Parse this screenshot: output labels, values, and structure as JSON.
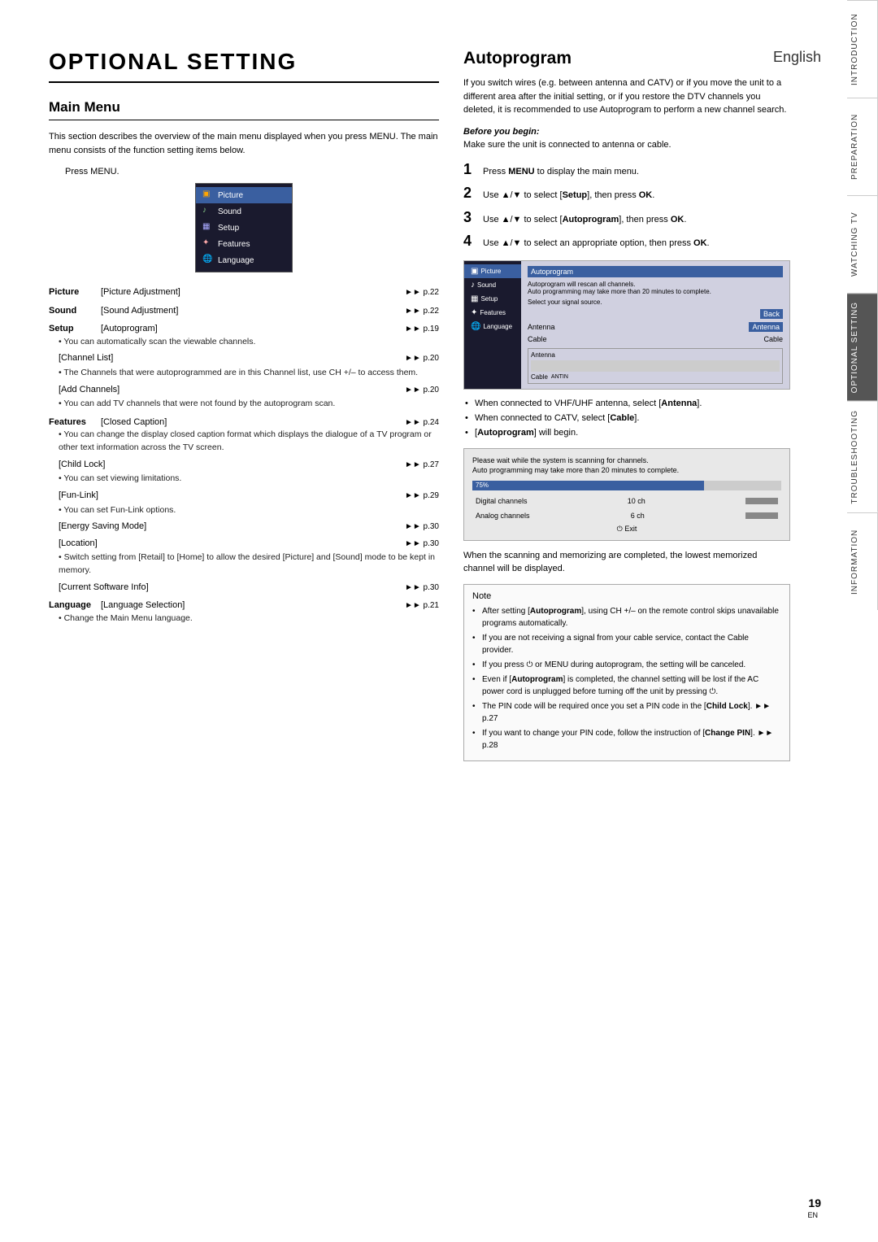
{
  "language": "English",
  "page_number": "19",
  "page_number_sub": "EN",
  "side_tabs": [
    {
      "label": "INTRODUCTION",
      "active": false
    },
    {
      "label": "PREPARATION",
      "active": false
    },
    {
      "label": "WATCHING TV",
      "active": false
    },
    {
      "label": "OPTIONAL SETTING",
      "active": true
    },
    {
      "label": "TROUBLESHOOTING",
      "active": false
    },
    {
      "label": "INFORMATION",
      "active": false
    }
  ],
  "left": {
    "main_title": "OPTIONAL SETTING",
    "sub_title": "Main Menu",
    "intro": "This section describes the overview of the main menu displayed when you press MENU. The main menu consists of the function setting items below.",
    "press_menu": "Press MENU.",
    "menu_items": [
      {
        "label": "Picture",
        "icon": "🖼"
      },
      {
        "label": "Sound",
        "icon": "🔊"
      },
      {
        "label": "Setup",
        "icon": "⚙"
      },
      {
        "label": "Features",
        "icon": "✦"
      },
      {
        "label": "Language",
        "icon": "🌐"
      }
    ],
    "entries": [
      {
        "category": "Picture",
        "items": [
          {
            "name": "[Picture Adjustment]",
            "page": "p.22",
            "bullets": []
          }
        ]
      },
      {
        "category": "Sound",
        "items": [
          {
            "name": "[Sound Adjustment]",
            "page": "p.22",
            "bullets": []
          }
        ]
      },
      {
        "category": "Setup",
        "items": [
          {
            "name": "[Autoprogram]",
            "page": "p.19",
            "bullets": [
              "You can automatically scan the viewable channels."
            ]
          },
          {
            "name": "[Channel List]",
            "page": "p.20",
            "bullets": [
              "The Channels that were autoprogrammed are in this Channel list, use CH +/– to access them."
            ]
          },
          {
            "name": "[Add Channels]",
            "page": "p.20",
            "bullets": [
              "You can add TV channels that were not found by the autoprogram scan."
            ]
          }
        ]
      },
      {
        "category": "Features",
        "items": [
          {
            "name": "[Closed Caption]",
            "page": "p.24",
            "bullets": [
              "You can change the display closed caption format which displays the dialogue of a TV program or other text information across the TV screen."
            ]
          },
          {
            "name": "[Child Lock]",
            "page": "p.27",
            "bullets": [
              "You can set viewing limitations."
            ]
          },
          {
            "name": "[Fun-Link]",
            "page": "p.29",
            "bullets": [
              "You can set Fun-Link options."
            ]
          },
          {
            "name": "[Energy Saving Mode]",
            "page": "p.30",
            "bullets": []
          },
          {
            "name": "[Location]",
            "page": "p.30",
            "bullets": [
              "Switch setting from [Retail] to [Home] to allow the desired [Picture] and [Sound] mode to be kept in memory."
            ]
          },
          {
            "name": "[Current Software Info]",
            "page": "p.30",
            "bullets": []
          }
        ]
      },
      {
        "category": "Language",
        "items": [
          {
            "name": "[Language Selection]",
            "page": "p.21",
            "bullets": [
              "Change the Main Menu language."
            ]
          }
        ]
      }
    ]
  },
  "right": {
    "title": "Autoprogram",
    "intro": "If you switch wires (e.g. between antenna and CATV) or if you move the unit to a different area after the initial setting, or if you restore the DTV channels you deleted, it is recommended to use Autoprogram to perform a new channel search.",
    "before_begin_label": "Before you begin:",
    "before_begin_text": "Make sure the unit is connected to antenna or cable.",
    "steps": [
      {
        "number": "1",
        "text": "Press MENU to display the main menu."
      },
      {
        "number": "2",
        "text": "Use ▲/▼ to select [Setup], then press OK."
      },
      {
        "number": "3",
        "text": "Use ▲/▼ to select [Autoprogram], then press OK."
      },
      {
        "number": "4",
        "text": "Use ▲/▼ to select an appropriate option, then press OK."
      }
    ],
    "screenshot_title": "Autoprogram",
    "screenshot_options": [
      "Back",
      "Antenna",
      "Cable"
    ],
    "screenshot_note_text": "Autoprogram will rescan all channels. Auto programming may take more than 20 minutes to complete.",
    "screenshot_select_text": "Select your signal source.",
    "bullets_after_screenshot": [
      "When connected to VHF/UHF antenna, select [Antenna].",
      "When connected to CATV, select [Cable].",
      "[Autoprogram] will begin."
    ],
    "progress_note": "Please wait while the system is scanning for channels.\nAuto programming may take more than 20 minutes to complete.",
    "progress_percent": "75%",
    "digital_channels_label": "Digital channels",
    "digital_channels_value": "10 ch",
    "analog_channels_label": "Analog channels",
    "analog_channels_value": "6 ch",
    "exit_label": "Exit",
    "scanning_complete_text": "When the scanning and memorizing are completed, the lowest memorized channel will be displayed.",
    "note_title": "Note",
    "notes": [
      "After setting [Autoprogram], using CH +/– on the remote control skips unavailable programs automatically.",
      "If you are not receiving a signal from your cable service, contact the Cable provider.",
      "If you press ⏻ or MENU during autoprogram, the setting will be canceled.",
      "Even if [Autoprogram] is completed, the channel setting will be lost if the AC power cord is unplugged before turning off the unit by pressing ⏻.",
      "The PIN code will be required once you set a PIN code in the [Child Lock]. ➡ p.27",
      "If you want to change your PIN code, follow the instruction of [Change PIN]. ➡ p.28"
    ]
  }
}
